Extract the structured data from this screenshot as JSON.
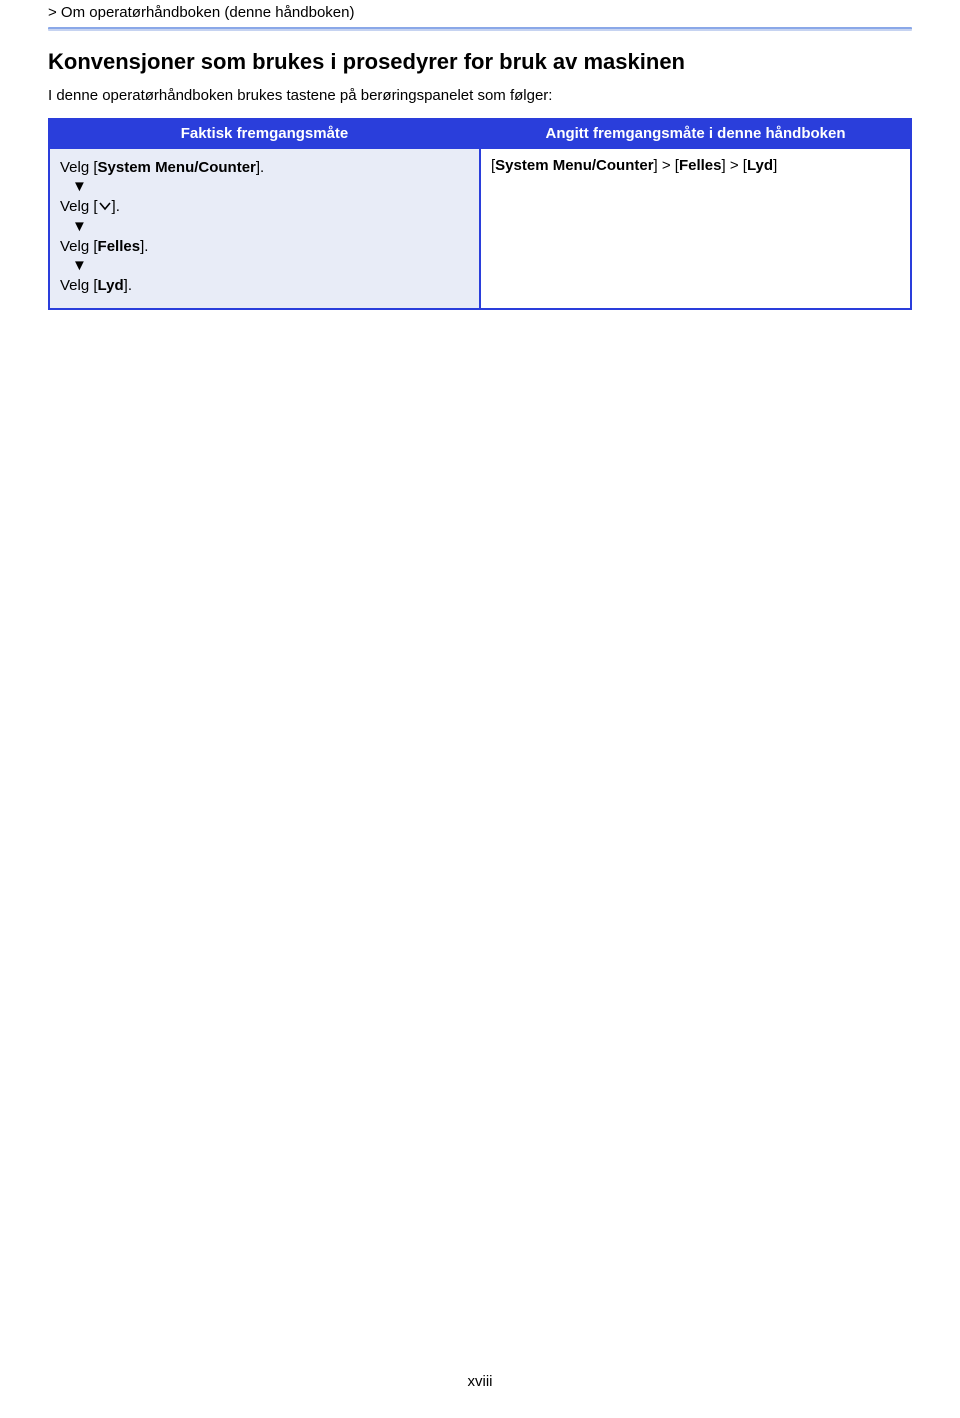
{
  "breadcrumb": "> Om operatørhåndboken (denne håndboken)",
  "heading": "Konvensjoner som brukes i prosedyrer for bruk av maskinen",
  "intro": "I denne operatørhåndboken brukes tastene på berøringspanelet som følger:",
  "table": {
    "headers": {
      "left": "Faktisk fremgangsmåte",
      "right": "Angitt fremgangsmåte i denne håndboken"
    },
    "left_steps": {
      "s1_prefix": "Velg [",
      "s1_bold": "System Menu/Counter",
      "s1_suffix": "].",
      "s2_prefix": "Velg [",
      "s2_suffix": "].",
      "s3_prefix": "Velg [",
      "s3_bold": "Felles",
      "s3_suffix": "].",
      "s4_prefix": "Velg [",
      "s4_bold": "Lyd",
      "s4_suffix": "]."
    },
    "right_cell": {
      "p1": "[",
      "b1": "System Menu/Counter",
      "p2": "]  > [",
      "b2": "Felles",
      "p3": "] > [",
      "b3": "Lyd",
      "p4": "]"
    }
  },
  "page_number": "xviii"
}
